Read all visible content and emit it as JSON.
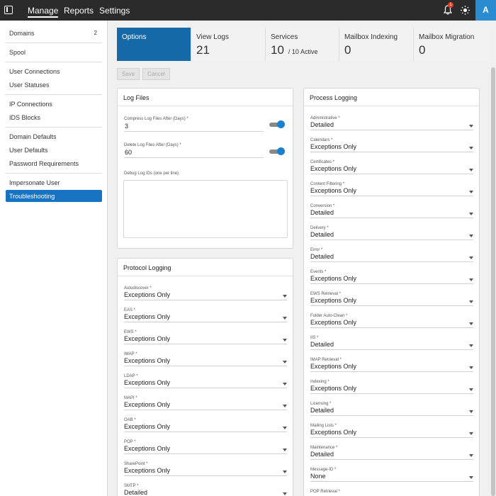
{
  "topbar": {
    "nav": [
      "Manage",
      "Reports",
      "Settings"
    ],
    "notification_count": "1",
    "avatar_initial": "A"
  },
  "sidebar": {
    "items": [
      {
        "label": "Domains",
        "count": "2"
      },
      {
        "label": "Spool"
      },
      {
        "label": "User Connections"
      },
      {
        "label": "User Statuses"
      },
      {
        "label": "IP Connections"
      },
      {
        "label": "IDS Blocks"
      },
      {
        "label": "Domain Defaults"
      },
      {
        "label": "User Defaults"
      },
      {
        "label": "Password Requirements"
      },
      {
        "label": "Impersonate User"
      },
      {
        "label": "Troubleshooting"
      }
    ]
  },
  "tabs": [
    {
      "label": "Options",
      "value": ""
    },
    {
      "label": "View Logs",
      "value": "21"
    },
    {
      "label": "Services",
      "value": "10",
      "sub": "/ 10 Active"
    },
    {
      "label": "Mailbox Indexing",
      "value": "0"
    },
    {
      "label": "Mailbox Migration",
      "value": "0"
    }
  ],
  "buttons": {
    "save": "Save",
    "cancel": "Cancel"
  },
  "log_files": {
    "title": "Log Files",
    "compress_label": "Compress Log Files After (Days) *",
    "compress_value": "3",
    "compress_enabled": true,
    "delete_label": "Delete Log Files After (Days) *",
    "delete_value": "60",
    "delete_enabled": true,
    "debug_label": "Debug Log IDs (one per line)"
  },
  "protocol_logging": {
    "title": "Protocol Logging",
    "fields": [
      {
        "label": "Autodiscover *",
        "value": "Exceptions Only"
      },
      {
        "label": "EAS *",
        "value": "Exceptions Only"
      },
      {
        "label": "EWS *",
        "value": "Exceptions Only"
      },
      {
        "label": "IMAP *",
        "value": "Exceptions Only"
      },
      {
        "label": "LDAP *",
        "value": "Exceptions Only"
      },
      {
        "label": "MAPI *",
        "value": "Exceptions Only"
      },
      {
        "label": "OAB *",
        "value": "Exceptions Only"
      },
      {
        "label": "POP *",
        "value": "Exceptions Only"
      },
      {
        "label": "SharePoint *",
        "value": "Exceptions Only"
      },
      {
        "label": "SMTP *",
        "value": "Detailed"
      }
    ]
  },
  "process_logging": {
    "title": "Process Logging",
    "fields": [
      {
        "label": "Administrative *",
        "value": "Detailed"
      },
      {
        "label": "Calendars *",
        "value": "Exceptions Only"
      },
      {
        "label": "Certificates *",
        "value": "Exceptions Only"
      },
      {
        "label": "Content Filtering *",
        "value": "Exceptions Only"
      },
      {
        "label": "Conversion *",
        "value": "Detailed"
      },
      {
        "label": "Delivery *",
        "value": "Detailed"
      },
      {
        "label": "Error *",
        "value": "Detailed"
      },
      {
        "label": "Events *",
        "value": "Exceptions Only"
      },
      {
        "label": "EWS Retrieval *",
        "value": "Exceptions Only"
      },
      {
        "label": "Folder Auto-Clean *",
        "value": "Exceptions Only"
      },
      {
        "label": "IIS *",
        "value": "Detailed"
      },
      {
        "label": "IMAP Retrieval *",
        "value": "Exceptions Only"
      },
      {
        "label": "Indexing *",
        "value": "Exceptions Only"
      },
      {
        "label": "Licensing *",
        "value": "Detailed"
      },
      {
        "label": "Mailing Lists *",
        "value": "Exceptions Only"
      },
      {
        "label": "Maintenance *",
        "value": "Detailed"
      },
      {
        "label": "Message-ID *",
        "value": "None"
      },
      {
        "label": "POP Retrieval *",
        "value": ""
      }
    ]
  },
  "colors": {
    "accent": "#1669a8",
    "active_nav": "#1873c2",
    "topbar": "#2b2b2b",
    "avatar": "#2a8bd1"
  }
}
